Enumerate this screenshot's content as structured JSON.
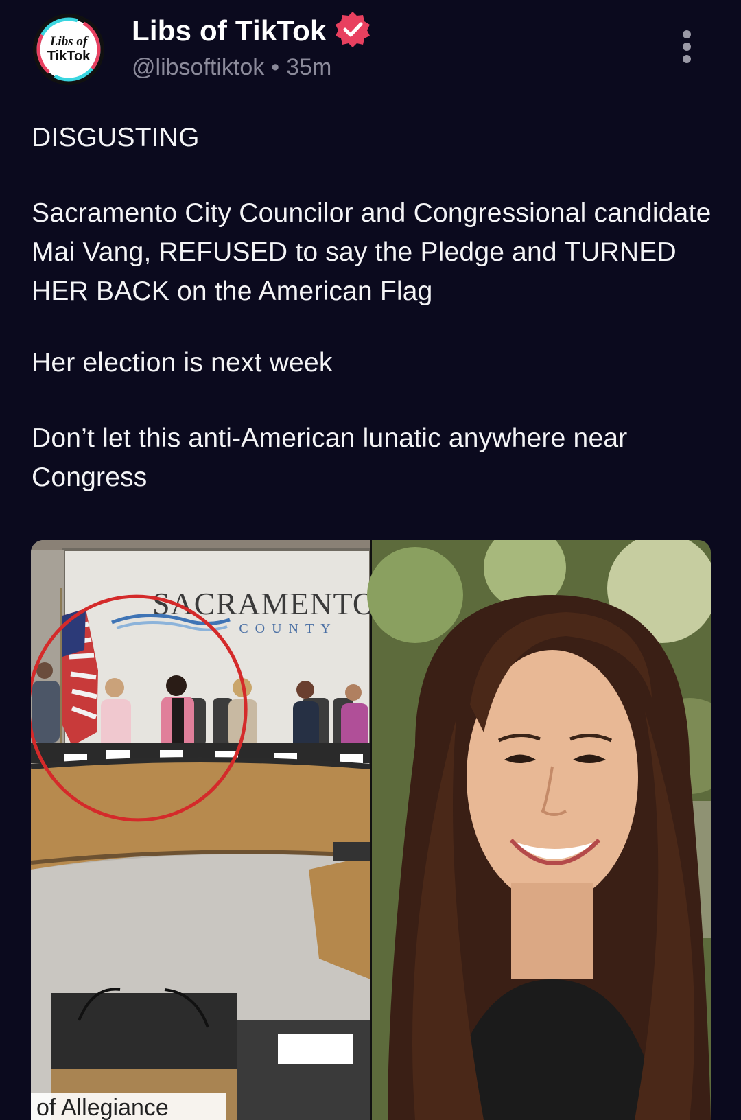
{
  "author": {
    "display_name": "Libs of TikTok",
    "handle": "@libsoftiktok",
    "separator": "•",
    "time_ago": "35m",
    "avatar_text_line1": "Libs of",
    "avatar_text_line2": "TikTok",
    "verified_icon": "verified-badge-icon"
  },
  "post": {
    "paragraphs": [
      "DISGUSTING",
      "Sacramento City Councilor and Congressional candidate Mai Vang, REFUSED to say the Pledge and TURNED HER BACK on the American Flag",
      "Her election is next week",
      "Don’t let this anti-American lunatic anywhere near Congress"
    ]
  },
  "media": {
    "left_image": {
      "wall_sign_line1": "SACRAMENTO",
      "wall_sign_line2": "COUNTY",
      "caption": "of Allegiance"
    },
    "right_image": {}
  },
  "colors": {
    "background": "#0b0a1e",
    "text": "#f4f4f6",
    "secondary_text": "#8b8a9a",
    "verified_badge": "#e8405f",
    "circle_highlight": "#d42a2a"
  }
}
